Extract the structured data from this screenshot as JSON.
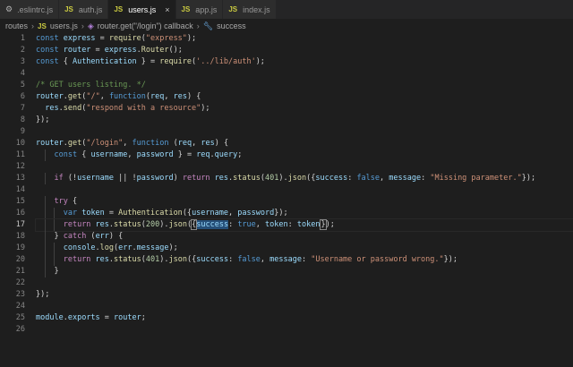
{
  "tabs": [
    {
      "label": ".eslintrc.js",
      "badge": "",
      "active": false
    },
    {
      "label": "auth.js",
      "badge": "JS",
      "active": false
    },
    {
      "label": "users.js",
      "badge": "JS",
      "active": true
    },
    {
      "label": "app.js",
      "badge": "JS",
      "active": false
    },
    {
      "label": "index.js",
      "badge": "JS",
      "active": false
    }
  ],
  "tab_close_glyph": "×",
  "breadcrumbs": {
    "folder": "routes",
    "file": "users.js",
    "file_badge": "JS",
    "symbol": "router.get(\"/login\") callback",
    "member": "success"
  },
  "editor": {
    "current_line": 17,
    "lines": [
      {
        "n": "1",
        "tokens": [
          [
            "kw",
            "const"
          ],
          [
            "pl",
            " "
          ],
          [
            "var",
            "express"
          ],
          [
            "pl",
            " = "
          ],
          [
            "fn",
            "require"
          ],
          [
            "pl",
            "("
          ],
          [
            "str",
            "\"express\""
          ],
          [
            "pl",
            ");"
          ]
        ]
      },
      {
        "n": "2",
        "tokens": [
          [
            "kw",
            "const"
          ],
          [
            "pl",
            " "
          ],
          [
            "var",
            "router"
          ],
          [
            "pl",
            " = "
          ],
          [
            "var",
            "express"
          ],
          [
            "pl",
            "."
          ],
          [
            "fn",
            "Router"
          ],
          [
            "pl",
            "();"
          ]
        ]
      },
      {
        "n": "3",
        "tokens": [
          [
            "kw",
            "const"
          ],
          [
            "pl",
            " { "
          ],
          [
            "var",
            "Authentication"
          ],
          [
            "pl",
            " } = "
          ],
          [
            "fn",
            "require"
          ],
          [
            "pl",
            "("
          ],
          [
            "str",
            "'../lib/auth'"
          ],
          [
            "pl",
            ");"
          ]
        ]
      },
      {
        "n": "4",
        "tokens": []
      },
      {
        "n": "5",
        "tokens": [
          [
            "cm",
            "/* GET users listing. */"
          ]
        ]
      },
      {
        "n": "6",
        "tokens": [
          [
            "var",
            "router"
          ],
          [
            "pl",
            "."
          ],
          [
            "fn",
            "get"
          ],
          [
            "pl",
            "("
          ],
          [
            "str",
            "\"/\""
          ],
          [
            "pl",
            ", "
          ],
          [
            "kw",
            "function"
          ],
          [
            "pl",
            "("
          ],
          [
            "var",
            "req"
          ],
          [
            "pl",
            ", "
          ],
          [
            "var",
            "res"
          ],
          [
            "pl",
            ") {"
          ]
        ]
      },
      {
        "n": "7",
        "tokens": [
          [
            "pl",
            "  "
          ],
          [
            "var",
            "res"
          ],
          [
            "pl",
            "."
          ],
          [
            "fn",
            "send"
          ],
          [
            "pl",
            "("
          ],
          [
            "str",
            "\"respond with a resource\""
          ],
          [
            "pl",
            ");"
          ]
        ]
      },
      {
        "n": "8",
        "tokens": [
          [
            "pl",
            "});"
          ]
        ]
      },
      {
        "n": "9",
        "tokens": []
      },
      {
        "n": "10",
        "tokens": [
          [
            "var",
            "router"
          ],
          [
            "pl",
            "."
          ],
          [
            "fn",
            "get"
          ],
          [
            "pl",
            "("
          ],
          [
            "str",
            "\"/login\""
          ],
          [
            "pl",
            ", "
          ],
          [
            "kw",
            "function"
          ],
          [
            "pl",
            " ("
          ],
          [
            "var",
            "req"
          ],
          [
            "pl",
            ", "
          ],
          [
            "var",
            "res"
          ],
          [
            "pl",
            ") {"
          ]
        ]
      },
      {
        "n": "11",
        "tokens": [
          [
            "pl",
            "    "
          ],
          [
            "kw",
            "const"
          ],
          [
            "pl",
            " { "
          ],
          [
            "var",
            "username"
          ],
          [
            "pl",
            ", "
          ],
          [
            "var",
            "password"
          ],
          [
            "pl",
            " } = "
          ],
          [
            "var",
            "req"
          ],
          [
            "pl",
            "."
          ],
          [
            "var",
            "query"
          ],
          [
            "pl",
            ";"
          ]
        ]
      },
      {
        "n": "12",
        "tokens": []
      },
      {
        "n": "13",
        "tokens": [
          [
            "pl",
            "    "
          ],
          [
            "ctl",
            "if"
          ],
          [
            "pl",
            " (!"
          ],
          [
            "var",
            "username"
          ],
          [
            "pl",
            " || !"
          ],
          [
            "var",
            "password"
          ],
          [
            "pl",
            ") "
          ],
          [
            "ctl",
            "return"
          ],
          [
            "pl",
            " "
          ],
          [
            "var",
            "res"
          ],
          [
            "pl",
            "."
          ],
          [
            "fn",
            "status"
          ],
          [
            "pl",
            "("
          ],
          [
            "num",
            "401"
          ],
          [
            "pl",
            ")."
          ],
          [
            "fn",
            "json"
          ],
          [
            "pl",
            "({"
          ],
          [
            "var",
            "success"
          ],
          [
            "pl",
            ": "
          ],
          [
            "kw",
            "false"
          ],
          [
            "pl",
            ", "
          ],
          [
            "var",
            "message"
          ],
          [
            "pl",
            ": "
          ],
          [
            "str",
            "\"Missing parameter.\""
          ],
          [
            "pl",
            "});"
          ]
        ]
      },
      {
        "n": "14",
        "tokens": []
      },
      {
        "n": "15",
        "tokens": [
          [
            "pl",
            "    "
          ],
          [
            "ctl",
            "try"
          ],
          [
            "pl",
            " {"
          ]
        ]
      },
      {
        "n": "16",
        "tokens": [
          [
            "pl",
            "      "
          ],
          [
            "kw",
            "var"
          ],
          [
            "pl",
            " "
          ],
          [
            "var",
            "token"
          ],
          [
            "pl",
            " = "
          ],
          [
            "fn",
            "Authentication"
          ],
          [
            "pl",
            "({"
          ],
          [
            "var",
            "username"
          ],
          [
            "pl",
            ", "
          ],
          [
            "var",
            "password"
          ],
          [
            "pl",
            "});"
          ]
        ]
      },
      {
        "n": "17",
        "tokens": [
          [
            "pl",
            "      "
          ],
          [
            "ctl",
            "return"
          ],
          [
            "pl",
            " "
          ],
          [
            "var",
            "res"
          ],
          [
            "pl",
            "."
          ],
          [
            "fn",
            "status"
          ],
          [
            "pl",
            "("
          ],
          [
            "num",
            "200"
          ],
          [
            "pl",
            ")."
          ],
          [
            "fn",
            "json"
          ],
          [
            "pl",
            "("
          ],
          [
            "br",
            "{"
          ],
          [
            "sel",
            "success"
          ],
          [
            "pl",
            ": "
          ],
          [
            "kw",
            "true"
          ],
          [
            "pl",
            ", "
          ],
          [
            "var",
            "token"
          ],
          [
            "pl",
            ": "
          ],
          [
            "var",
            "token"
          ],
          [
            "cur",
            ""
          ],
          [
            "br",
            "}"
          ],
          [
            "pl",
            ");"
          ]
        ]
      },
      {
        "n": "18",
        "tokens": [
          [
            "pl",
            "    } "
          ],
          [
            "ctl",
            "catch"
          ],
          [
            "pl",
            " ("
          ],
          [
            "var",
            "err"
          ],
          [
            "pl",
            ") {"
          ]
        ]
      },
      {
        "n": "19",
        "tokens": [
          [
            "pl",
            "      "
          ],
          [
            "var",
            "console"
          ],
          [
            "pl",
            "."
          ],
          [
            "fn",
            "log"
          ],
          [
            "pl",
            "("
          ],
          [
            "var",
            "err"
          ],
          [
            "pl",
            "."
          ],
          [
            "var",
            "message"
          ],
          [
            "pl",
            ");"
          ]
        ]
      },
      {
        "n": "20",
        "tokens": [
          [
            "pl",
            "      "
          ],
          [
            "ctl",
            "return"
          ],
          [
            "pl",
            " "
          ],
          [
            "var",
            "res"
          ],
          [
            "pl",
            "."
          ],
          [
            "fn",
            "status"
          ],
          [
            "pl",
            "("
          ],
          [
            "num",
            "401"
          ],
          [
            "pl",
            ")."
          ],
          [
            "fn",
            "json"
          ],
          [
            "pl",
            "({"
          ],
          [
            "var",
            "success"
          ],
          [
            "pl",
            ": "
          ],
          [
            "kw",
            "false"
          ],
          [
            "pl",
            ", "
          ],
          [
            "var",
            "message"
          ],
          [
            "pl",
            ": "
          ],
          [
            "str",
            "\"Username or password wrong.\""
          ],
          [
            "pl",
            "});"
          ]
        ]
      },
      {
        "n": "21",
        "tokens": [
          [
            "pl",
            "    }"
          ]
        ]
      },
      {
        "n": "22",
        "tokens": []
      },
      {
        "n": "23",
        "tokens": [
          [
            "pl",
            "});"
          ]
        ]
      },
      {
        "n": "24",
        "tokens": []
      },
      {
        "n": "25",
        "tokens": [
          [
            "var",
            "module"
          ],
          [
            "pl",
            "."
          ],
          [
            "var",
            "exports"
          ],
          [
            "pl",
            " = "
          ],
          [
            "var",
            "router"
          ],
          [
            "pl",
            ";"
          ]
        ]
      },
      {
        "n": "26",
        "tokens": []
      }
    ]
  }
}
